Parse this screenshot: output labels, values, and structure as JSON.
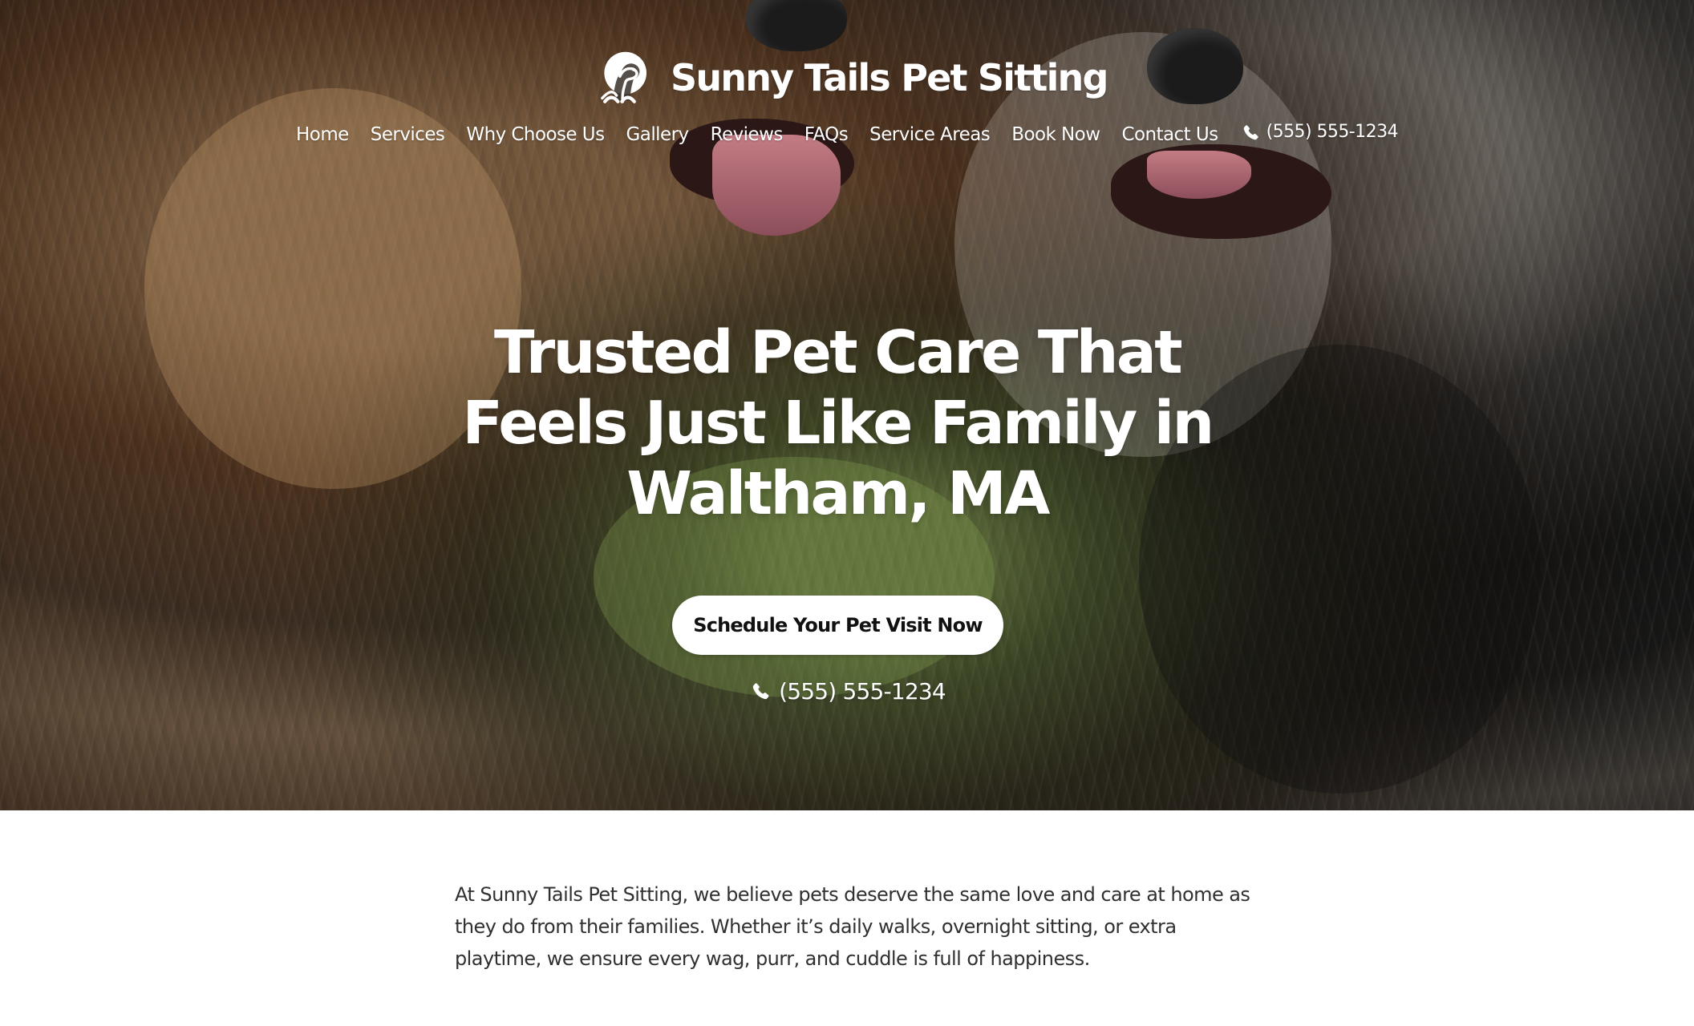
{
  "site": {
    "brand_name": "Sunny Tails Pet Sitting",
    "logo_icon": "dog-logo-icon"
  },
  "navigation": {
    "items": [
      {
        "label": "Home"
      },
      {
        "label": "Services"
      },
      {
        "label": "Why Choose Us"
      },
      {
        "label": "Gallery"
      },
      {
        "label": "Reviews"
      },
      {
        "label": "FAQs"
      },
      {
        "label": "Service Areas"
      },
      {
        "label": "Book Now"
      },
      {
        "label": "Contact Us"
      }
    ],
    "phone": "(555) 555-1234",
    "phone_icon": "phone-icon"
  },
  "hero": {
    "heading": "Trusted Pet Care That Feels Just Like Family in Waltham, MA",
    "cta_label": "Schedule Your Pet Visit Now",
    "phone": "(555) 555-1234",
    "phone_icon": "phone-icon"
  },
  "intro": {
    "text": "At Sunny Tails Pet Sitting, we believe pets deserve the same love and care at home as they do from their families. Whether it’s daily walks, overnight sitting, or extra playtime, we ensure every wag, purr, and cuddle is full of happiness."
  },
  "colors": {
    "hero_text": "#ffffff",
    "button_background": "#ffffff",
    "button_text": "#111111",
    "body_text": "#303030"
  }
}
